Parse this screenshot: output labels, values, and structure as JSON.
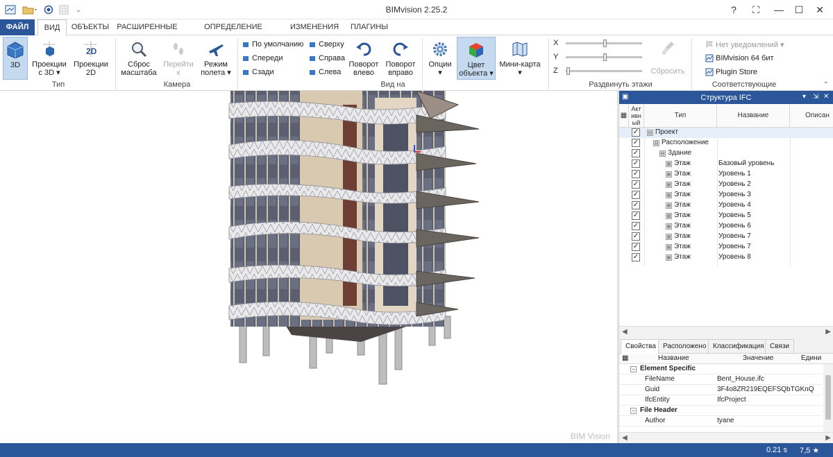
{
  "window": {
    "title": "BIMvision 2.25.2",
    "controls": [
      "?",
      "⛶",
      "—",
      "☐",
      "✕"
    ]
  },
  "ribbon_tabs": [
    {
      "label": "ФАЙЛ"
    },
    {
      "label": "ВИД"
    },
    {
      "label": "ОБЪЕКТЫ"
    },
    {
      "label": "РАСШИРЕННЫЕ"
    },
    {
      "label": "ОПРЕДЕЛЕНИЕ РАЗМЕРОВ"
    },
    {
      "label": "ИЗМЕНЕНИЯ"
    },
    {
      "label": "ПЛАГИНЫ"
    }
  ],
  "ribbon": {
    "type_group": {
      "label": "Тип",
      "btn_3d": "3D",
      "btn_proj3d_1": "Проекции",
      "btn_proj3d_2": "с 3D ▾",
      "btn_proj2d_1": "Проекции",
      "btn_proj2d_2": "2D",
      "icon_2d": "2D"
    },
    "camera_group": {
      "label": "Камера",
      "reset_1": "Сброс",
      "reset_2": "масштаба",
      "goto_1": "Перейти",
      "goto_2": "к",
      "flight_1": "Режим",
      "flight_2": "полета ▾"
    },
    "view_group": {
      "label": "Вид на",
      "default": "По умолчанию",
      "front": "Спереди",
      "back": "Сзади",
      "top": "Сверху",
      "right": "Справа",
      "left": "Слева",
      "rot_left_1": "Поворот",
      "rot_left_2": "влево",
      "rot_right_1": "Поворот",
      "rot_right_2": "вправо",
      "options_1": "Опции",
      "options_2": "▾",
      "color_1": "Цвет",
      "color_2": "объекта ▾",
      "minimap": "Мини-карта ▾"
    },
    "split_group": {
      "label": "Раздвинуть этажи",
      "x": "X",
      "y": "Y",
      "z": "Z",
      "reset": "Сбросить",
      "slider_x": 0.5,
      "slider_y": 0.5,
      "slider_z": 0.0
    },
    "compat_group": {
      "label": "Соответствующие программы",
      "no_notify": "Нет уведомлений ▾",
      "bimvision64": "BIMvision 64 бит",
      "plugin_store": "Plugin Store"
    }
  },
  "viewport": {
    "watermark": "BIM Vision"
  },
  "ifc_panel": {
    "title": "Структура IFC",
    "col_active": "Акт\nивн\nый",
    "col_active_1": "Акт",
    "col_active_2": "ивн",
    "col_active_3": "ый",
    "col_type": "Тип",
    "col_name": "Название",
    "col_desc": "Описан",
    "rows": [
      {
        "type": "Проект",
        "name": "",
        "level": 0,
        "expander": "⊟"
      },
      {
        "type": "Расположение",
        "name": "",
        "level": 1,
        "expander": "⊟"
      },
      {
        "type": "Здание",
        "name": "",
        "level": 2,
        "expander": "⊟"
      },
      {
        "type": "Этаж",
        "name": "Базовый уровень",
        "level": 3,
        "expander": "⊞"
      },
      {
        "type": "Этаж",
        "name": "Уровень 1",
        "level": 3,
        "expander": "⊞"
      },
      {
        "type": "Этаж",
        "name": "Уровень 2",
        "level": 3,
        "expander": "⊞"
      },
      {
        "type": "Этаж",
        "name": "Уровень 3",
        "level": 3,
        "expander": "⊞"
      },
      {
        "type": "Этаж",
        "name": "Уровень 4",
        "level": 3,
        "expander": "⊞"
      },
      {
        "type": "Этаж",
        "name": "Уровень 5",
        "level": 3,
        "expander": "⊞"
      },
      {
        "type": "Этаж",
        "name": "Уровень 6",
        "level": 3,
        "expander": "⊞"
      },
      {
        "type": "Этаж",
        "name": "Уровень 7",
        "level": 3,
        "expander": "⊞"
      },
      {
        "type": "Этаж",
        "name": "Уровень 7",
        "level": 3,
        "expander": "⊞"
      },
      {
        "type": "Этаж",
        "name": "Уровень 8",
        "level": 3,
        "expander": "⊞"
      }
    ]
  },
  "properties": {
    "tabs": [
      "Свойства",
      "Расположено",
      "Классификация",
      "Связи"
    ],
    "col_name": "Название",
    "col_value": "Значение",
    "col_unit": "Едини",
    "rows": [
      {
        "kind": "cat",
        "key": "Element Specific",
        "value": ""
      },
      {
        "kind": "row",
        "key": "FileName",
        "value": "Bent_House.ifc"
      },
      {
        "kind": "row",
        "key": "Guid",
        "value": "3F4o8ZR219EQEFSQbTGKnQ"
      },
      {
        "kind": "row",
        "key": "IfcEntity",
        "value": "IfcProject"
      },
      {
        "kind": "cat",
        "key": "File Header",
        "value": ""
      },
      {
        "kind": "row",
        "key": "Author",
        "value": "tyane"
      }
    ]
  },
  "status": {
    "time": "0.21 s",
    "rating": "7,5 ★"
  },
  "colors": {
    "accent": "#2b579a",
    "selected_btn": "#c5d9ef"
  }
}
